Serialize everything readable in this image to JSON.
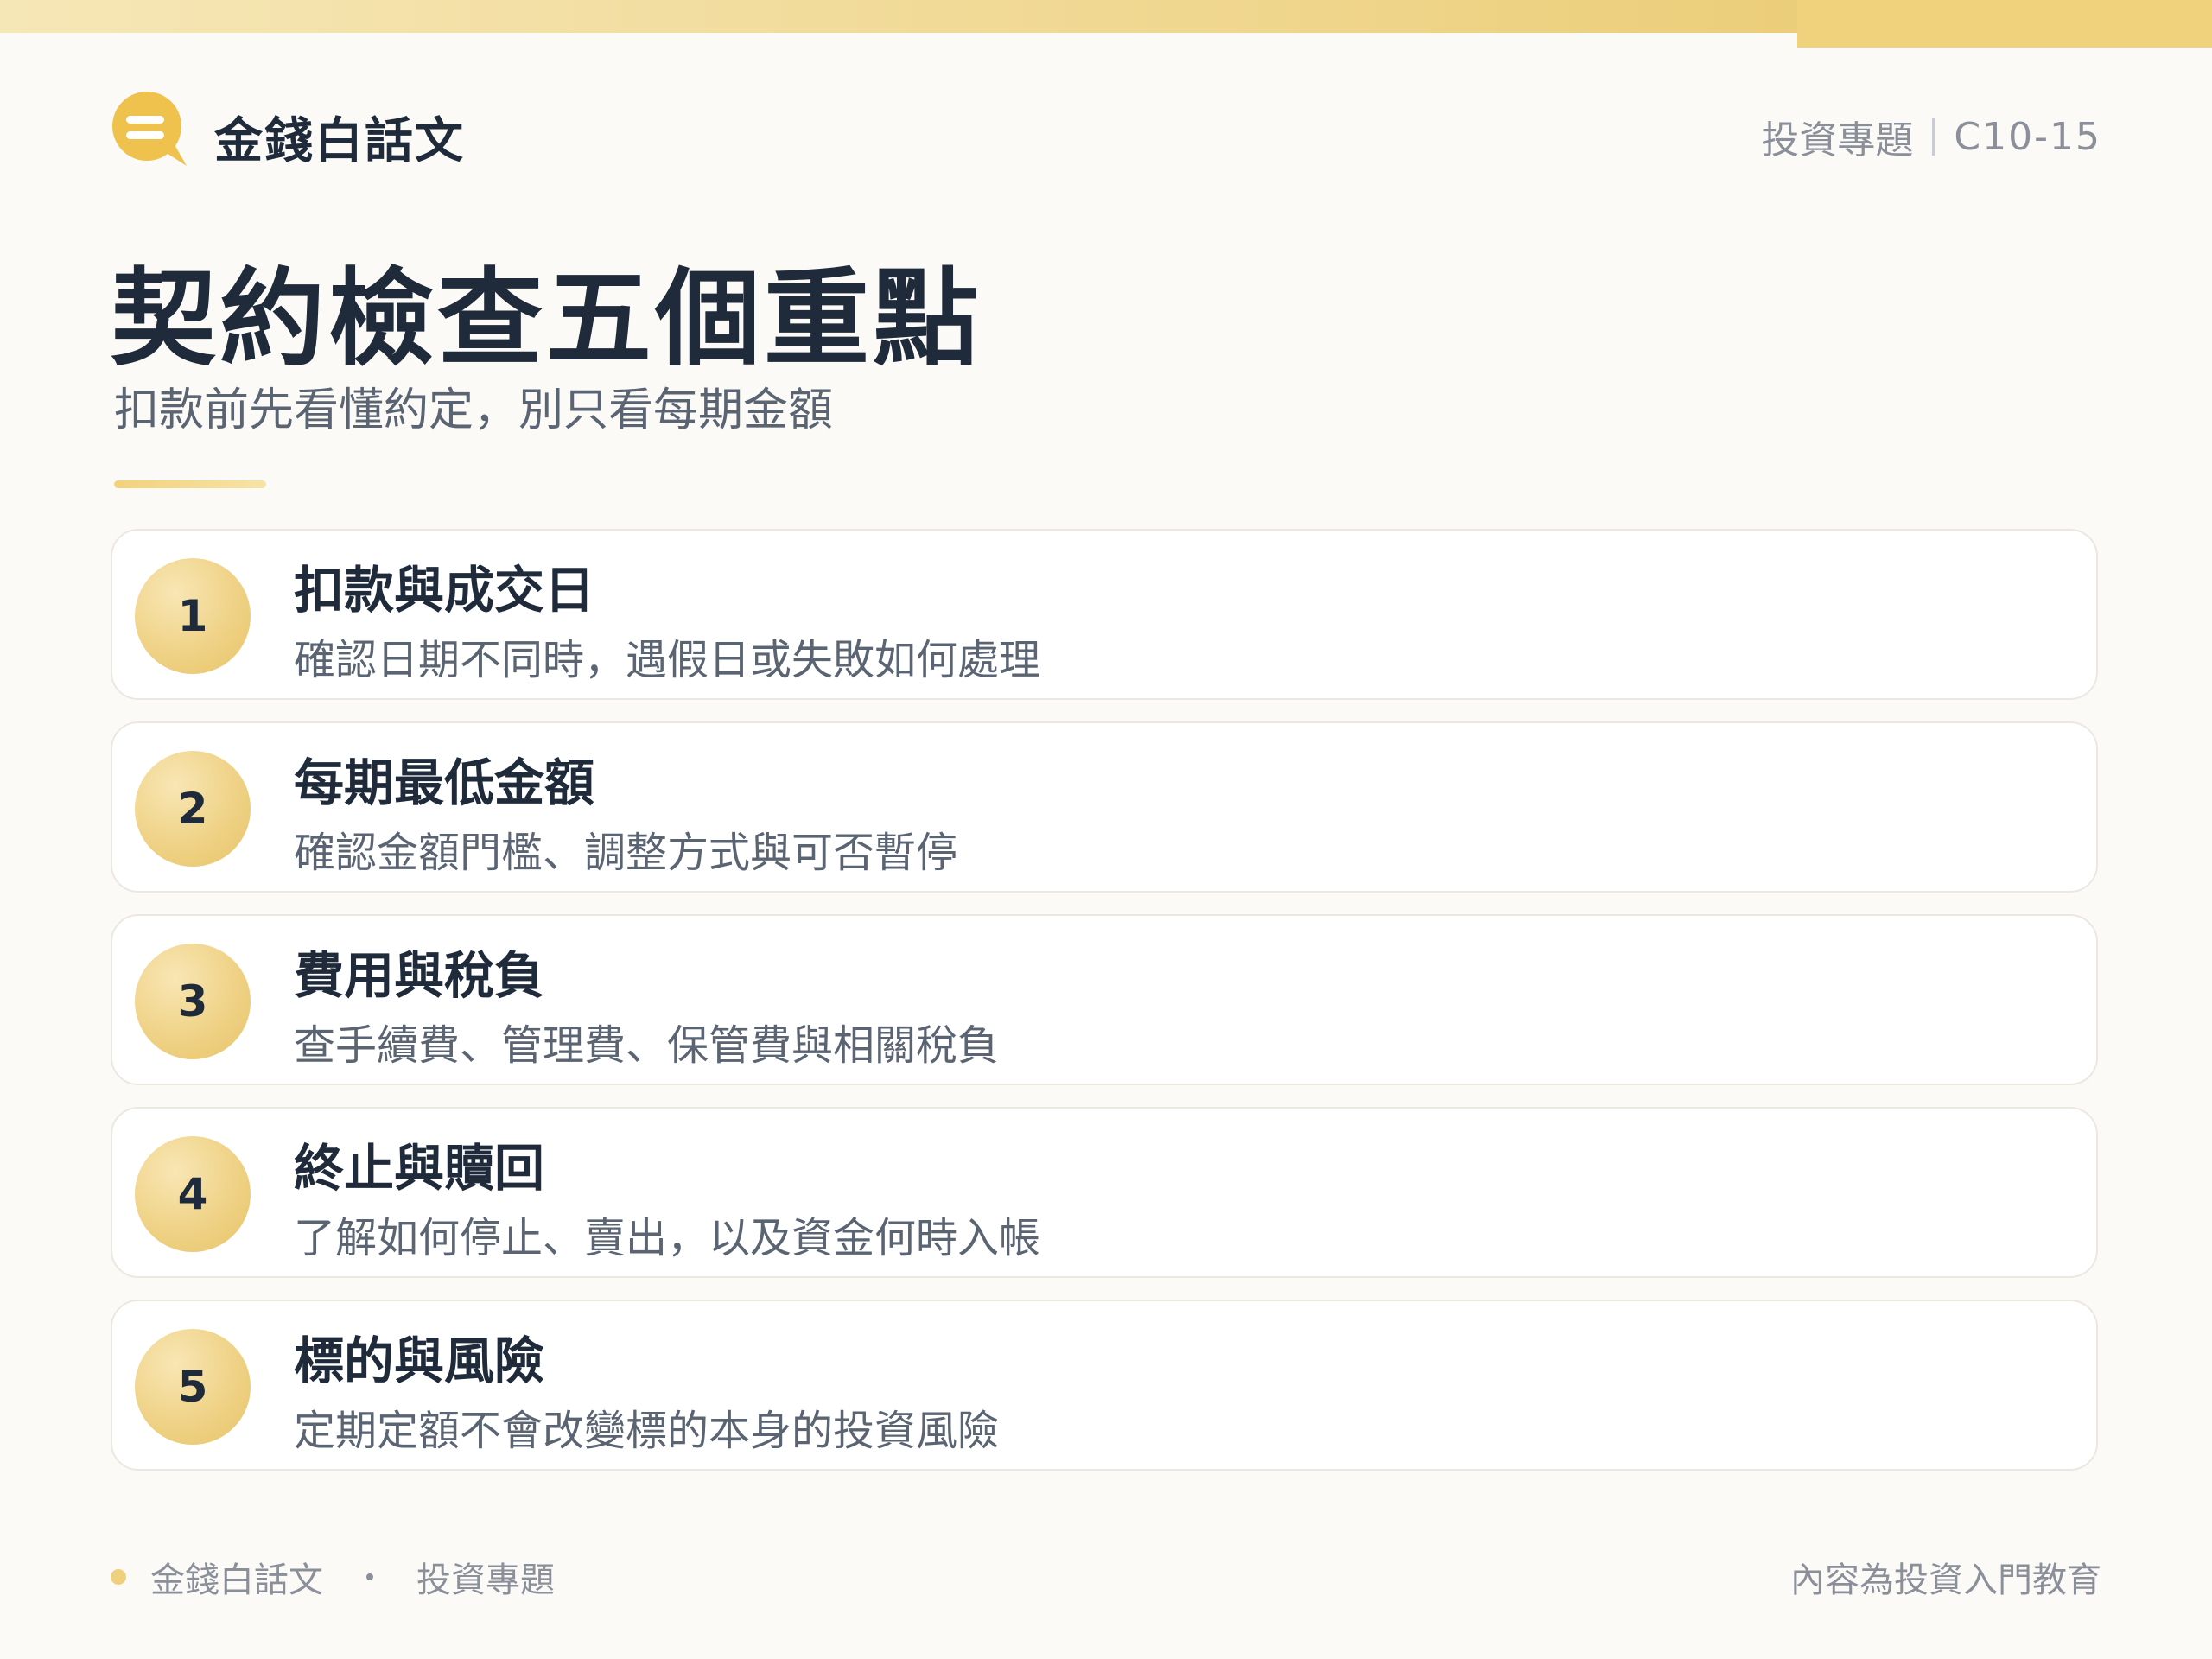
{
  "colors": {
    "accent": "#efd07c",
    "title": "#1f2a3a",
    "muted": "#8a8f99"
  },
  "brand": {
    "logo_icon": "chat-bubble-icon",
    "name": "金錢白話文"
  },
  "header": {
    "category": "投資專題",
    "code": "C10-15"
  },
  "page": {
    "title": "契約檢查五個重點",
    "subtitle": "扣款前先看懂約定，別只看每期金額"
  },
  "items": [
    {
      "number": "1",
      "title": "扣款與成交日",
      "desc": "確認日期不同時，遇假日或失敗如何處理"
    },
    {
      "number": "2",
      "title": "每期最低金額",
      "desc": "確認金額門檻、調整方式與可否暫停"
    },
    {
      "number": "3",
      "title": "費用與稅負",
      "desc": "查手續費、管理費、保管費與相關稅負"
    },
    {
      "number": "4",
      "title": "終止與贖回",
      "desc": "了解如何停止、賣出，以及資金何時入帳"
    },
    {
      "number": "5",
      "title": "標的與風險",
      "desc": "定期定額不會改變標的本身的投資風險"
    }
  ],
  "footer": {
    "brand": "金錢白話文",
    "category": "投資專題",
    "disclaimer": "內容為投資入門教育"
  }
}
